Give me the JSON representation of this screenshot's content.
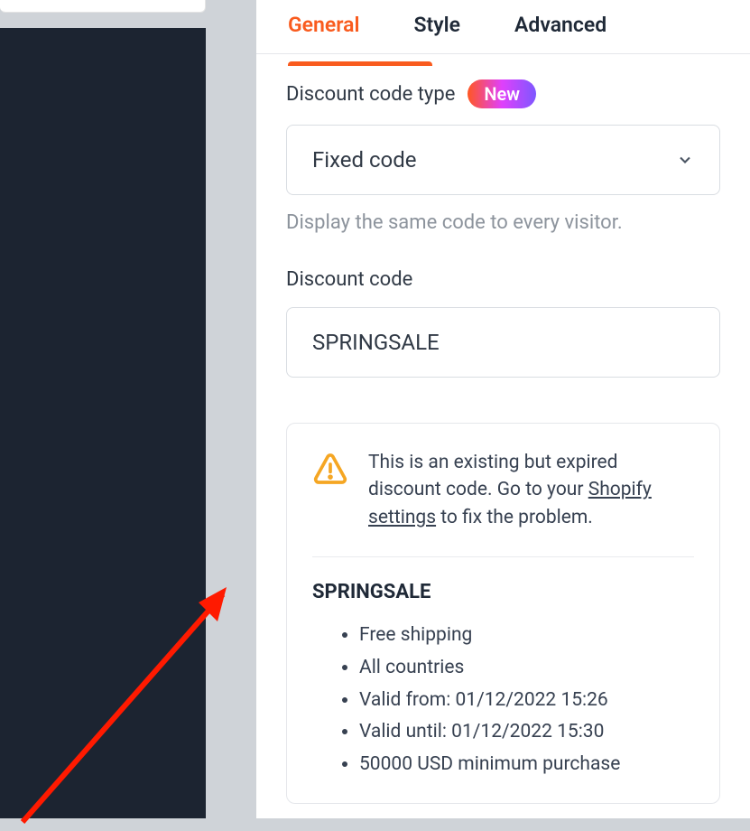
{
  "tabs": {
    "general": "General",
    "style": "Style",
    "advanced": "Advanced"
  },
  "discount_type": {
    "label": "Discount code type",
    "badge": "New",
    "value": "Fixed code",
    "helper": "Display the same code to every visitor."
  },
  "discount_code": {
    "label": "Discount code",
    "value": "SPRINGSALE"
  },
  "warning": {
    "text_prefix": "This is an existing but expired discount code. Go to your ",
    "link_text": "Shopify settings",
    "text_suffix": " to fix the problem."
  },
  "code_summary": {
    "title": "SPRINGSALE",
    "details": [
      "Free shipping",
      "All countries",
      "Valid from: 01/12/2022 15:26",
      "Valid until: 01/12/2022 15:30",
      "50000 USD minimum purchase"
    ]
  }
}
